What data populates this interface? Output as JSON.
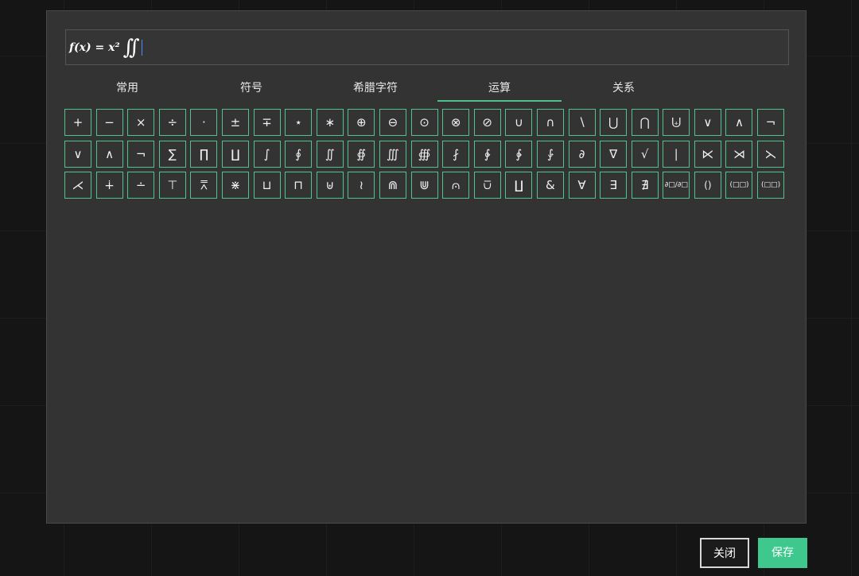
{
  "formula": {
    "text": "f(x) = x²",
    "integral": "∫∫"
  },
  "tabs": [
    {
      "label": "常用",
      "active": false
    },
    {
      "label": "符号",
      "active": false
    },
    {
      "label": "希腊字符",
      "active": false
    },
    {
      "label": "运算",
      "active": true
    },
    {
      "label": "关系",
      "active": false
    }
  ],
  "symbols": [
    "+",
    "−",
    "×",
    "÷",
    "·",
    "±",
    "∓",
    "⋆",
    "∗",
    "⊕",
    "⊖",
    "⊙",
    "⊗",
    "⊘",
    "∪",
    "∩",
    "∖",
    "⋃",
    "⋂",
    "⨄",
    "∨",
    "∧",
    "¬",
    "∨",
    "∧",
    "¬",
    "∑",
    "∏",
    "∐",
    "∫",
    "∮",
    "∬",
    "∯",
    "∭",
    "∰",
    "⨏",
    "∲",
    "∳",
    "⨑",
    "∂",
    "∇",
    "√",
    "∣",
    "⋉",
    "⋊",
    "⋋",
    "⋌",
    "∔",
    "∸",
    "⊤",
    "⩞",
    "⋇",
    "⊔",
    "⊓",
    "⊎",
    "≀",
    "⋒",
    "⋓",
    "⩀",
    "⩂",
    "∐",
    "&",
    "∀",
    "∃",
    "∄",
    "∂□/∂□",
    "()",
    "(□□)",
    "(□□)"
  ],
  "buttons": {
    "close": "关闭",
    "save": "保存"
  },
  "colors": {
    "accent": "#3fc88e",
    "dialog_bg": "#333333"
  }
}
